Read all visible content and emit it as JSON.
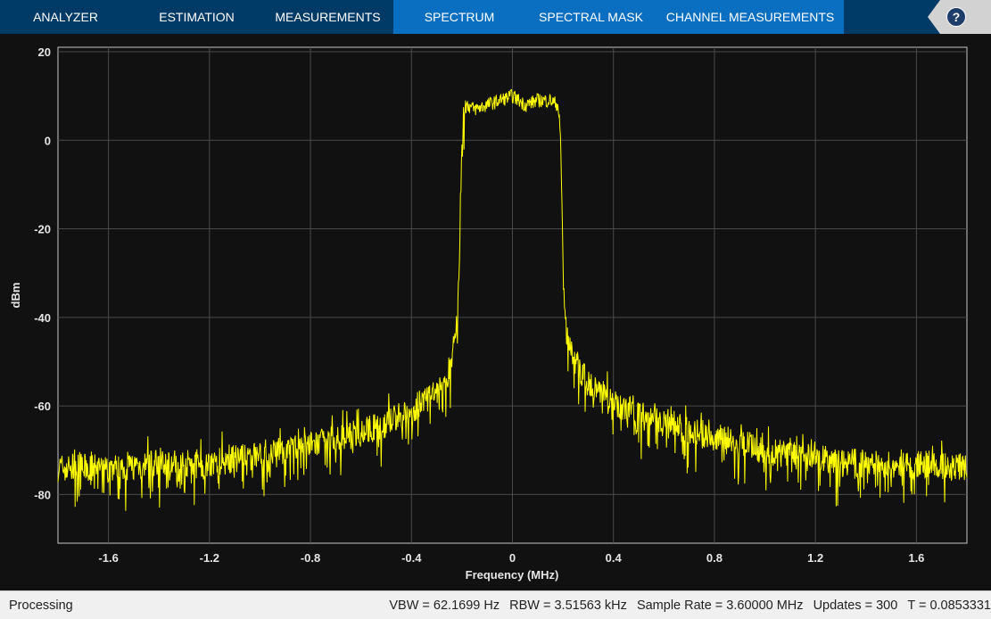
{
  "toolbar": {
    "tabs": [
      {
        "label": "ANALYZER"
      },
      {
        "label": "ESTIMATION"
      },
      {
        "label": "MEASUREMENTS"
      },
      {
        "label": "SPECTRUM"
      },
      {
        "label": "SPECTRAL MASK"
      },
      {
        "label": "CHANNEL MEASUREMENTS"
      }
    ],
    "help_label": "?"
  },
  "colors": {
    "toolbar_bg": "#003a66",
    "active_tab_bg": "#0a6fc0",
    "plot_bg": "#111111",
    "trace": "#ffff00",
    "grid": "#4a4a4a",
    "axis_text": "#e6e6e6"
  },
  "chart_data": {
    "type": "line",
    "xlabel": "Frequency (MHz)",
    "ylabel": "dBm",
    "xlim": [
      -1.8,
      1.8
    ],
    "ylim": [
      -91,
      21
    ],
    "xticks": [
      -1.6,
      -1.2,
      -0.8,
      -0.4,
      0,
      0.4,
      0.8,
      1.2,
      1.6
    ],
    "xtick_labels": [
      "-1.6",
      "-1.2",
      "-0.8",
      "-0.4",
      "0",
      "0.4",
      "0.8",
      "1.2",
      "1.6"
    ],
    "yticks": [
      20,
      0,
      -20,
      -40,
      -60,
      -80
    ],
    "ytick_labels": [
      "20",
      "0",
      "-20",
      "-40",
      "-60",
      "-80"
    ],
    "grid": true,
    "series": [
      {
        "x": [
          -1.8,
          -1.6,
          -1.4,
          -1.2,
          -1.0,
          -0.8,
          -0.6,
          -0.5,
          -0.4,
          -0.3,
          -0.25,
          -0.22,
          -0.21,
          -0.2,
          -0.19,
          -0.18,
          -0.15,
          -0.1,
          -0.05,
          0,
          0.05,
          0.1,
          0.15,
          0.18,
          0.19,
          0.2,
          0.21,
          0.22,
          0.25,
          0.3,
          0.4,
          0.5,
          0.6,
          0.8,
          1.0,
          1.2,
          1.4,
          1.6,
          1.8
        ],
        "y": [
          -74,
          -74,
          -73,
          -73,
          -71,
          -69,
          -66,
          -64,
          -61,
          -57,
          -52,
          -42,
          -25,
          2,
          7,
          8,
          7,
          8,
          9,
          10,
          8,
          9,
          9,
          8,
          2,
          -25,
          -40,
          -45,
          -50,
          -55,
          -59,
          -62,
          -64,
          -67,
          -70,
          -72,
          -73,
          -73,
          -74
        ]
      }
    ]
  },
  "status": {
    "state": "Processing",
    "vbw": "VBW = 62.1699 Hz",
    "rbw": "RBW = 3.51563 kHz",
    "sample_rate": "Sample Rate = 3.60000 MHz",
    "updates": "Updates = 300",
    "time": "T = 0.0853331"
  }
}
